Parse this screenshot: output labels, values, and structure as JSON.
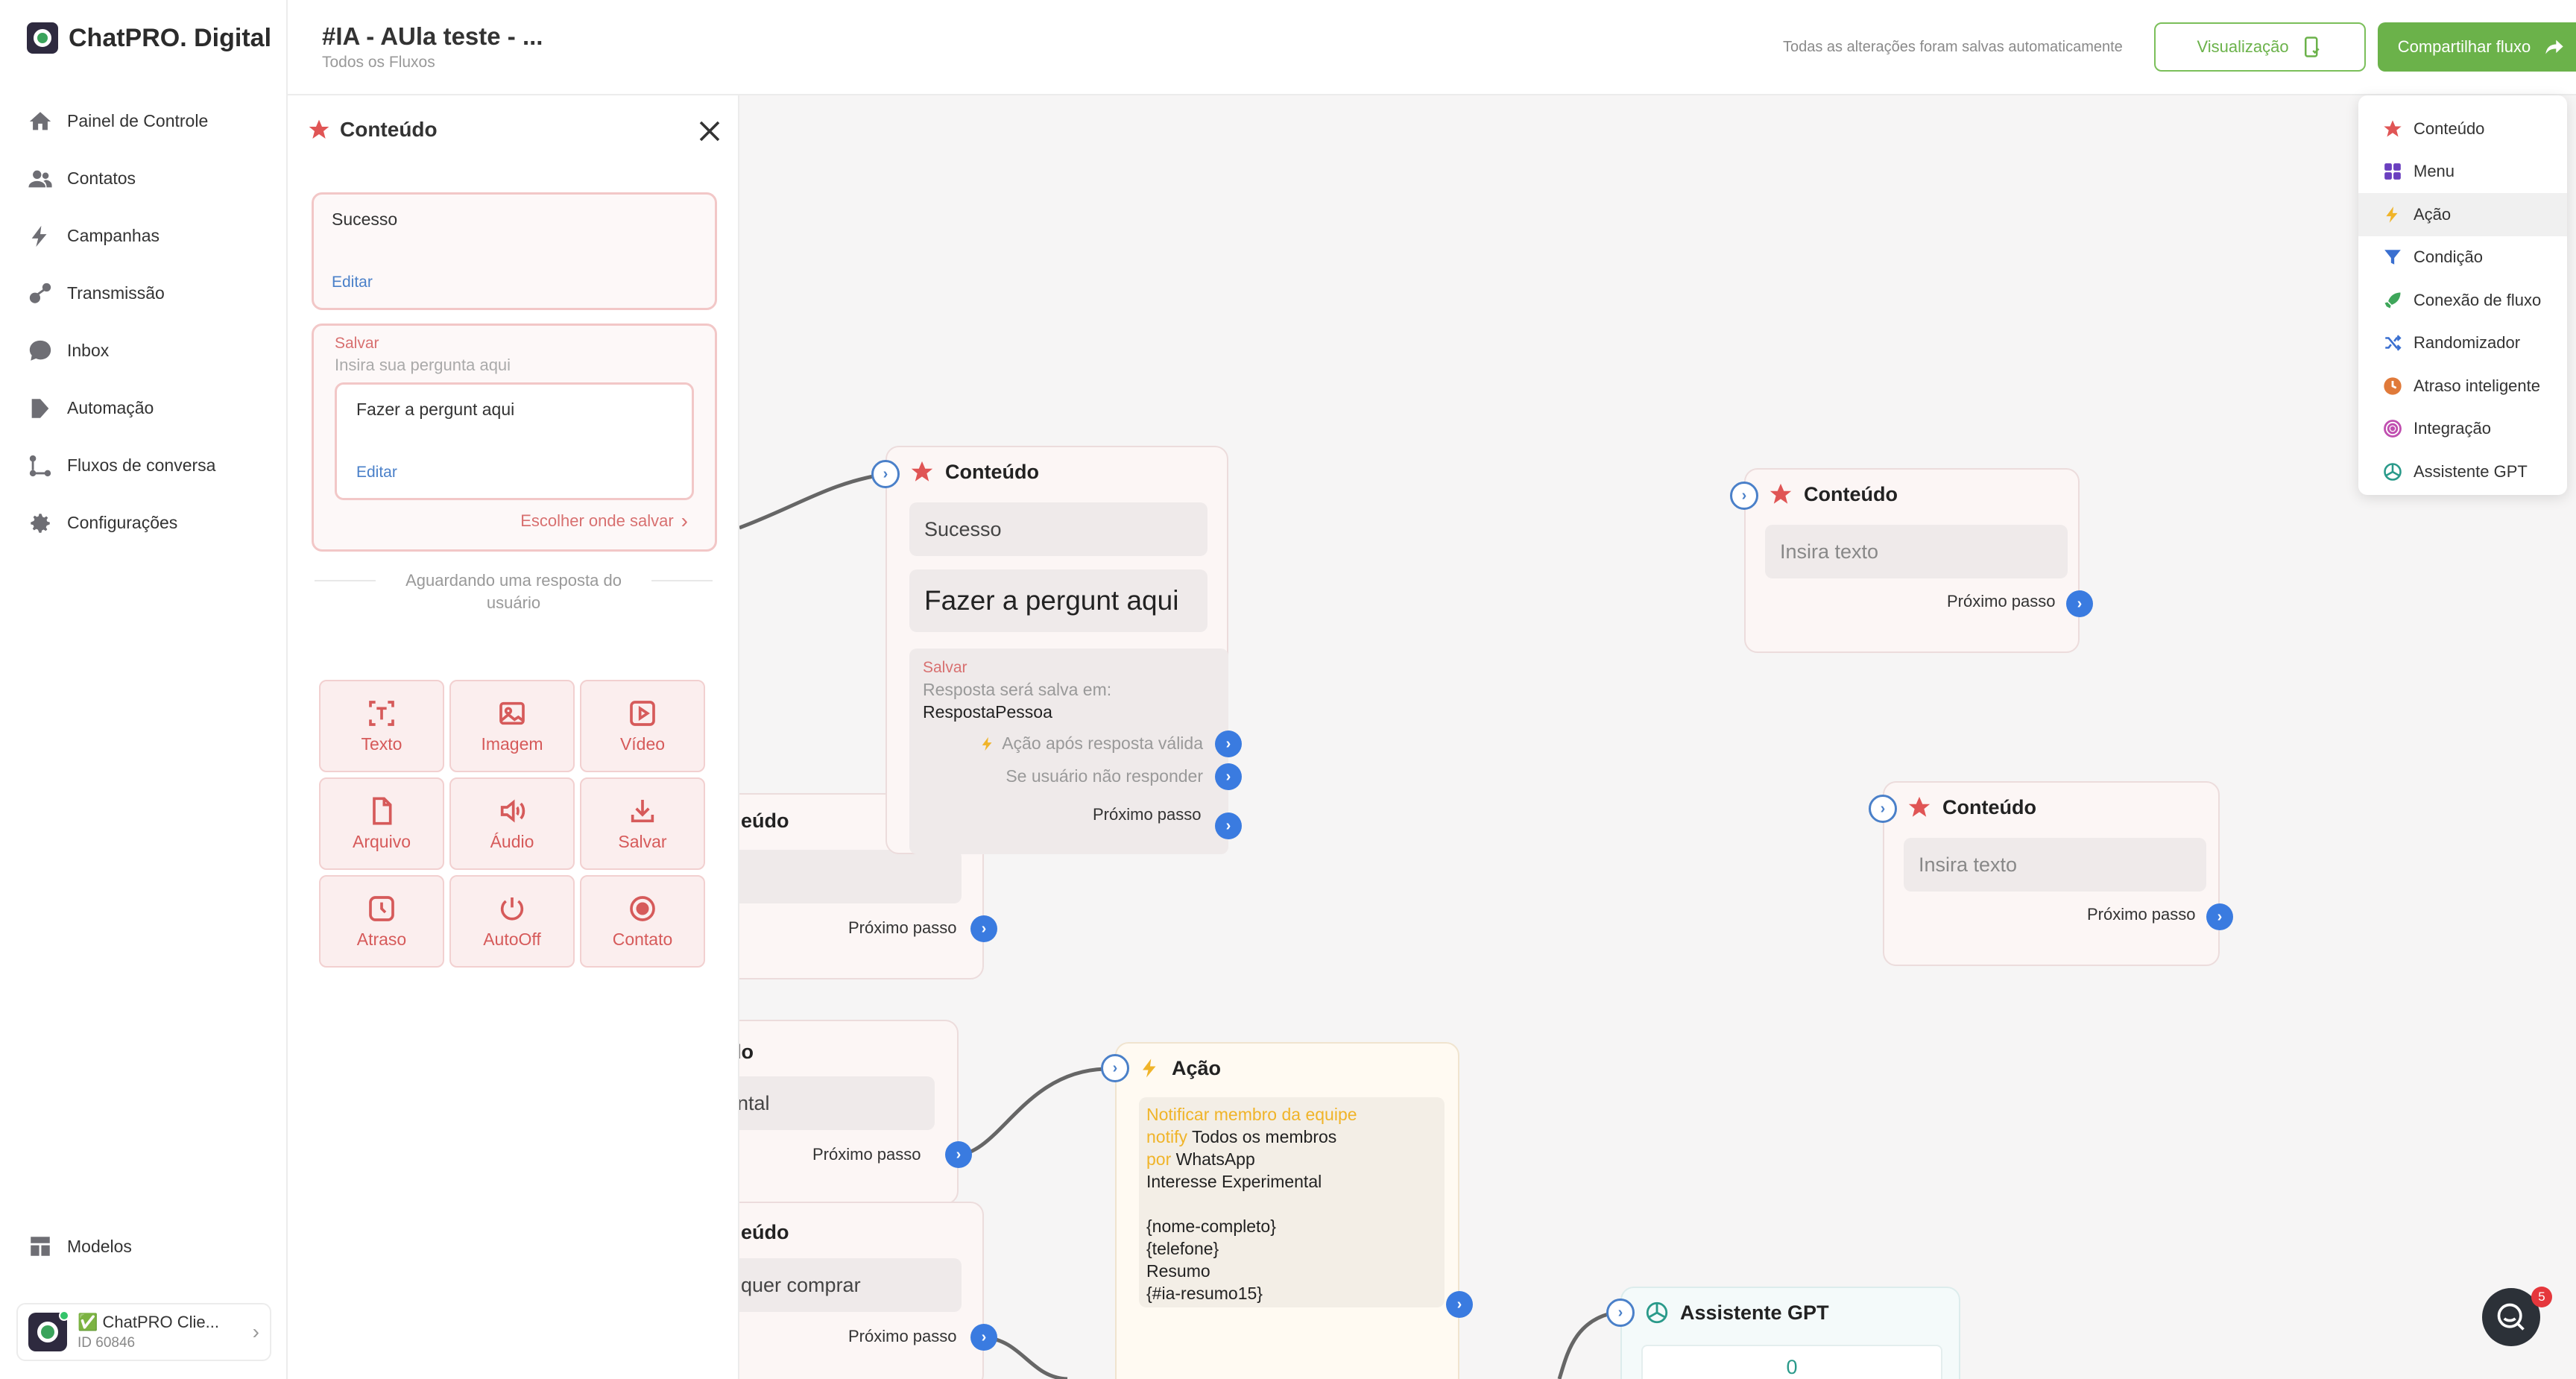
{
  "brand": {
    "name": "ChatPRO. Digital"
  },
  "nav": [
    {
      "label": "Painel de Controle",
      "icon": "home-icon"
    },
    {
      "label": "Contatos",
      "icon": "users-icon"
    },
    {
      "label": "Campanhas",
      "icon": "lightning-icon"
    },
    {
      "label": "Transmissão",
      "icon": "broadcast-icon"
    },
    {
      "label": "Inbox",
      "icon": "chat-bubble-icon"
    },
    {
      "label": "Automação",
      "icon": "automation-icon"
    },
    {
      "label": "Fluxos de conversa",
      "icon": "flow-icon"
    },
    {
      "label": "Configurações",
      "icon": "gear-icon"
    }
  ],
  "models": {
    "label": "Modelos"
  },
  "account": {
    "name": "✅ ChatPRO Clie...",
    "id": "ID 60846"
  },
  "topbar": {
    "title": "#IA - AUla teste - ...",
    "subtitle": "Todos os Fluxos",
    "autosave": "Todas as alterações foram salvas automaticamente",
    "preview_label": "Visualização",
    "share_label": "Compartilhar fluxo"
  },
  "panel": {
    "title": "Conteúdo",
    "card1_text": "Sucesso",
    "card1_edit": "Editar",
    "save_label": "Salvar",
    "question_placeholder": "Insira sua pergunta aqui",
    "question_text": "Fazer a pergunt aqui",
    "question_edit": "Editar",
    "choose_save": "Escolher onde salvar",
    "waiting": "Aguardando uma resposta do usuário",
    "tools": [
      {
        "label": "Texto",
        "icon": "text-icon"
      },
      {
        "label": "Imagem",
        "icon": "image-icon"
      },
      {
        "label": "Vídeo",
        "icon": "video-icon"
      },
      {
        "label": "Arquivo",
        "icon": "file-icon"
      },
      {
        "label": "Áudio",
        "icon": "audio-icon"
      },
      {
        "label": "Salvar",
        "icon": "save-icon"
      },
      {
        "label": "Atraso",
        "icon": "clock-icon"
      },
      {
        "label": "AutoOff",
        "icon": "power-icon"
      },
      {
        "label": "Contato",
        "icon": "contact-icon"
      }
    ]
  },
  "nodes": {
    "main": {
      "title": "Conteúdo",
      "field1": "Sucesso",
      "field2": "Fazer a pergunt aqui",
      "save_label": "Salvar",
      "save_desc": "Resposta será salva em:",
      "save_var": "RespostaPessoa",
      "action_valid": "Ação após resposta válida",
      "no_response": "Se usuário não responder",
      "next": "Próximo passo"
    },
    "right1": {
      "title": "Conteúdo",
      "placeholder": "Insira texto",
      "next": "Próximo passo"
    },
    "right2": {
      "title": "Conteúdo",
      "placeholder": "Insira texto",
      "next": "Próximo passo"
    },
    "partial1": {
      "title": "eúdo",
      "next": "Próximo passo"
    },
    "partial2": {
      "title": "do",
      "field": "ental",
      "next": "Próximo passo"
    },
    "partial3": {
      "title": "eúdo",
      "field": "quer comprar",
      "next": "Próximo passo"
    },
    "action": {
      "title": "Ação",
      "notify_label": "Notificar membro da equipe",
      "notify_prefix": "notify",
      "notify_target": "Todos os membros",
      "via_prefix": "por",
      "via_channel": "WhatsApp",
      "message_lines": [
        "Interesse Experimental",
        "",
        "{nome-completo}",
        "{telefone}",
        "Resumo",
        "{#ia-resumo15}"
      ]
    },
    "gpt": {
      "title": "Assistente GPT",
      "value": "0"
    }
  },
  "addmenu": [
    {
      "label": "Conteúdo",
      "icon": "star-icon",
      "color": "#e05555"
    },
    {
      "label": "Menu",
      "icon": "grid-icon",
      "color": "#6a3fbf"
    },
    {
      "label": "Ação",
      "icon": "lightning-icon",
      "color": "#f0b429"
    },
    {
      "label": "Condição",
      "icon": "filter-icon",
      "color": "#3a6fd0"
    },
    {
      "label": "Conexão de fluxo",
      "icon": "rocket-icon",
      "color": "#3ea65a"
    },
    {
      "label": "Randomizador",
      "icon": "shuffle-icon",
      "color": "#3a6fd0"
    },
    {
      "label": "Atraso inteligente",
      "icon": "clock-icon",
      "color": "#e07a3a"
    },
    {
      "label": "Integração",
      "icon": "integration-icon",
      "color": "#c04fb0"
    },
    {
      "label": "Assistente GPT",
      "icon": "openai-icon",
      "color": "#2a9a8a"
    }
  ],
  "chat": {
    "badge": "5"
  }
}
